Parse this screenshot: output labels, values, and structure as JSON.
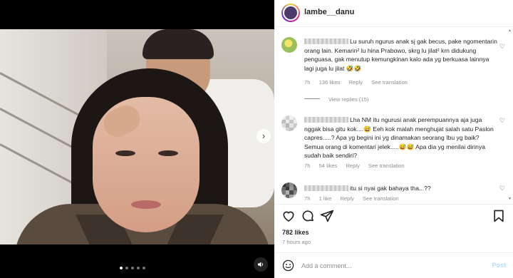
{
  "media": {
    "next_icon": "chevron-right-icon",
    "mute_icon": "speaker-icon",
    "dots_count": 5,
    "active_dot": 0
  },
  "header": {
    "username": "lambe__danu"
  },
  "comments": [
    {
      "text": "Lu suruh ngurus anak sj gak becus, pake ngomentarin orang lain. Kemarin² lu hina Prabowo, skrg lu jilat² krn didukung penguasa, gak menutup kemungkinan kalo ada yg berkuasa lainnya lagi juga lu jilat 🤣🤣",
      "time": "7h",
      "likes": "136 likes",
      "reply": "Reply",
      "translation": "See translation",
      "view_replies": "View replies (15)"
    },
    {
      "text": "Lha NM itu ngurusi anak perempuannya aja juga nggak bisa gitu kok....😅 Eeh kok malah menghujat salah satu Paslon capres.....? Apa yg begini ini yg dinamakan seorang Ibu yg baik? Semua orang di komentari jelek.....😅😅 Apa dia yg menilai dirinya sudah baik sendiri?",
      "time": "7h",
      "likes": "54 likes",
      "reply": "Reply",
      "translation": "See translation"
    },
    {
      "text": "itu si nyai gak bahaya tha...??",
      "time": "7h",
      "likes": "1 like",
      "reply": "Reply",
      "translation": "See translation"
    }
  ],
  "footer": {
    "likes": "782 likes",
    "time": "7 hours ago",
    "comment_placeholder": "Add a comment...",
    "post_label": "Post"
  },
  "colors": {
    "accent_post": "#b3dbff",
    "muted_text": "#8e8e8e",
    "primary_text": "#262626"
  }
}
